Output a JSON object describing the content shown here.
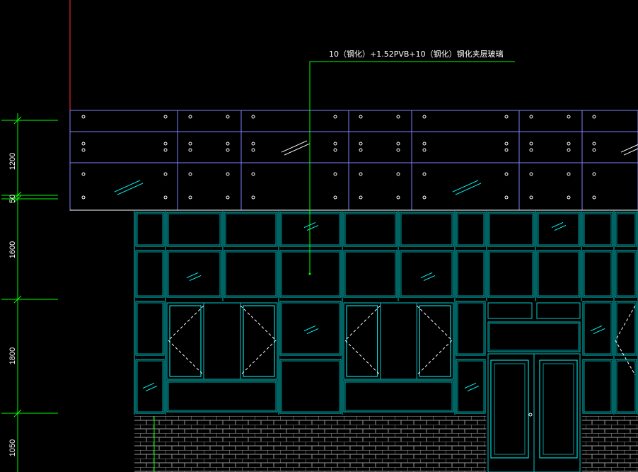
{
  "drawing": {
    "annotation": "10（钢化）+1.52PVB+10（钢化）钢化夹层玻璃",
    "dimensions": [
      "1200",
      "50",
      "1600",
      "1800",
      "1050"
    ]
  },
  "colors": {
    "background": "#000000",
    "dimension_line": "#00ff00",
    "leader_line": "#00ff00",
    "canopy_grid": "#8080ff",
    "curtain_wall": "#00c8c8",
    "inner_frame": "#00ffff",
    "brick": "#9a9a9a",
    "axis": "#ff3030",
    "text": "#ffffff"
  }
}
